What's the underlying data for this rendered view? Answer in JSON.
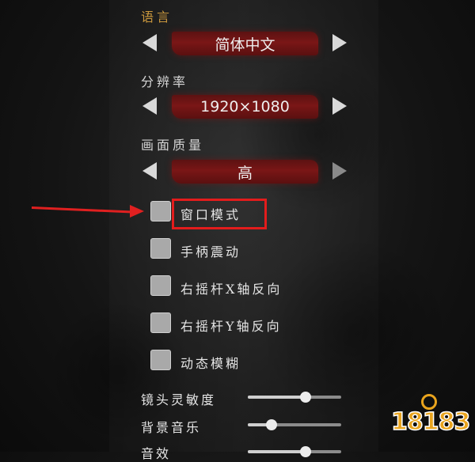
{
  "language": {
    "label": "语言",
    "value": "简体中文"
  },
  "resolution": {
    "label": "分辨率",
    "value": "1920×1080"
  },
  "quality": {
    "label": "画面质量",
    "value": "高"
  },
  "options": [
    {
      "label": "窗口模式",
      "checked": false
    },
    {
      "label": "手柄震动",
      "checked": false
    },
    {
      "label": "右摇杆X轴反向",
      "checked": false
    },
    {
      "label": "右摇杆Y轴反向",
      "checked": false
    },
    {
      "label": "动态模糊",
      "checked": false
    }
  ],
  "sliders": [
    {
      "label": "镜头灵敏度",
      "value": 0.62
    },
    {
      "label": "背景音乐",
      "value": 0.25
    },
    {
      "label": "音效",
      "value": 0.62
    }
  ],
  "watermark": {
    "text": "18183"
  },
  "colors": {
    "accent_label": "#c9973d",
    "value_bar": "#7a1616",
    "annotation": "#e31c1c"
  }
}
